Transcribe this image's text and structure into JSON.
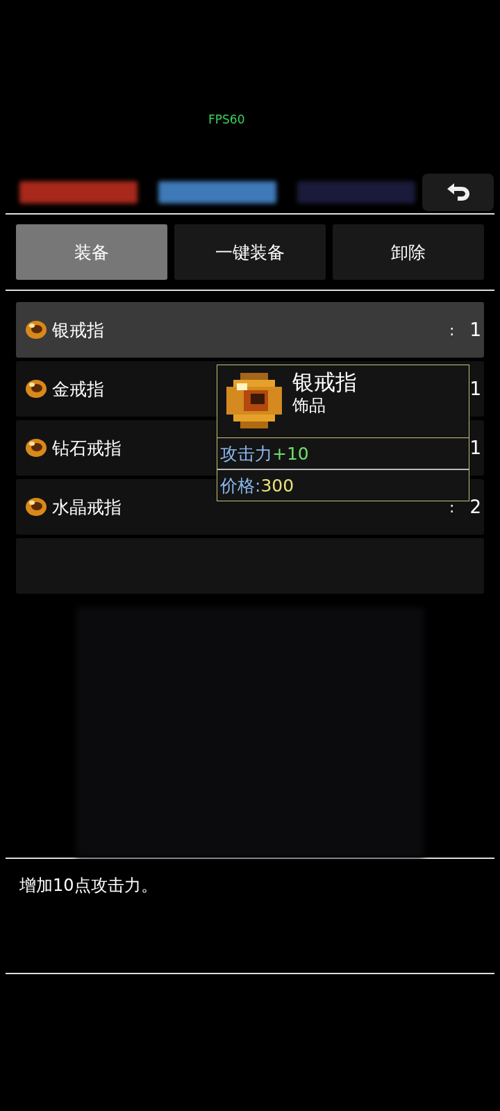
{
  "fps": "FPS60",
  "tabs": [
    {
      "label": "装备",
      "selected": true
    },
    {
      "label": "一键装备",
      "selected": false
    },
    {
      "label": "卸除",
      "selected": false
    }
  ],
  "items": [
    {
      "name": "银戒指",
      "sep": ":",
      "count": "1",
      "selected": true
    },
    {
      "name": "金戒指",
      "count": "1",
      "selected": false
    },
    {
      "name": "钻石戒指",
      "count": "1",
      "selected": false
    },
    {
      "name": "水晶戒指",
      "sep": ":",
      "count": "2",
      "selected": false
    }
  ],
  "tooltip": {
    "title": "银戒指",
    "category": "饰品",
    "stat_label": "攻击力",
    "stat_value": "+10",
    "price_label": "价格:",
    "price_value": "300"
  },
  "description": "增加10点攻击力。"
}
